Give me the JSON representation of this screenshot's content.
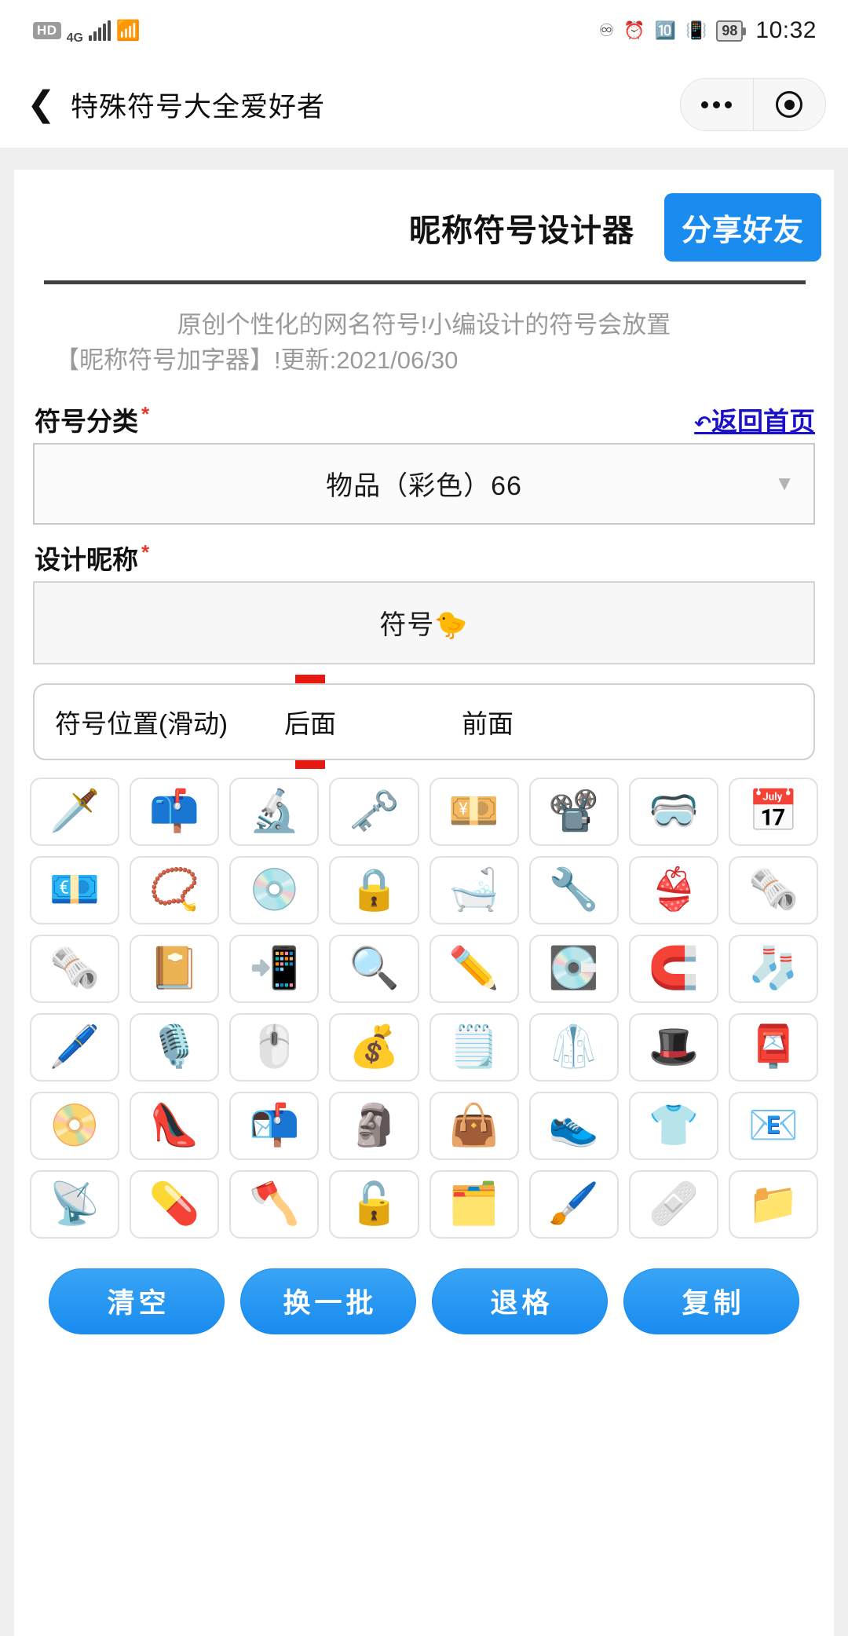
{
  "status_bar": {
    "hd_label": "HD",
    "network_label": "4G",
    "signal_icon": "signal-bars-icon",
    "wifi_icon": "wifi-icon",
    "headphone_icon": "headphones-icon",
    "alarm_icon": "alarm-clock-icon",
    "bluetooth_icon": "bluetooth-icon",
    "vibrate_icon": "vibrate-icon",
    "battery_percent": "98",
    "time": "10:32"
  },
  "nav": {
    "back_icon": "back-chevron-icon",
    "title": "特殊符号大全爱好者",
    "more_icon": "more-dots-icon",
    "close_icon": "target-circle-icon"
  },
  "header": {
    "app_title": "昵称符号设计器",
    "share_label": "分享好友",
    "accent_color": "#1a8cf0"
  },
  "description": {
    "line1": "原创个性化的网名符号!小编设计的符号会放置",
    "line2": "【昵称符号加字器】!更新:2021/06/30"
  },
  "category": {
    "label": "符号分类",
    "required_mark": "*",
    "home_link": "返回首页",
    "home_link_arrow": "↶",
    "home_link_color": "#1a11c9",
    "selected": "物品（彩色）66",
    "caret_icon": "chevron-down-icon"
  },
  "nickname": {
    "label": "设计昵称",
    "required_mark": "*",
    "value": "符号🐤"
  },
  "position_tabs": {
    "title": "符号位置(滑动)",
    "options": [
      "后面",
      "前面"
    ],
    "active_index": 0,
    "marker_color": "#e7180f"
  },
  "symbol_grid": {
    "columns": 8,
    "rows": [
      [
        "🗡️",
        "📫",
        "🔬",
        "🗝️",
        "💴",
        "📽️",
        "🥽",
        "📅"
      ],
      [
        "💶",
        "📿",
        "💿",
        "🔒",
        "🛁",
        "🔧",
        "👙",
        "🗞️"
      ],
      [
        "🗞️",
        "📔",
        "📲",
        "🔍",
        "✏️",
        "💽",
        "🧲",
        "🧦"
      ],
      [
        "🖊️",
        "🎙️",
        "🖱️",
        "💰",
        "🗒️",
        "🥼",
        "🎩",
        "📮"
      ],
      [
        "📀",
        "👠",
        "📬",
        "🗿",
        "👜",
        "👟",
        "👕",
        "📧"
      ],
      [
        "📡",
        "💊",
        "🪓",
        "🔓",
        "🗂️",
        "🖌️",
        "🩹",
        "📁"
      ]
    ]
  },
  "actions": [
    {
      "label": "清空",
      "name": "clear-button"
    },
    {
      "label": "换一批",
      "name": "refresh-batch-button"
    },
    {
      "label": "退格",
      "name": "backspace-button"
    },
    {
      "label": "复制",
      "name": "copy-button"
    }
  ]
}
